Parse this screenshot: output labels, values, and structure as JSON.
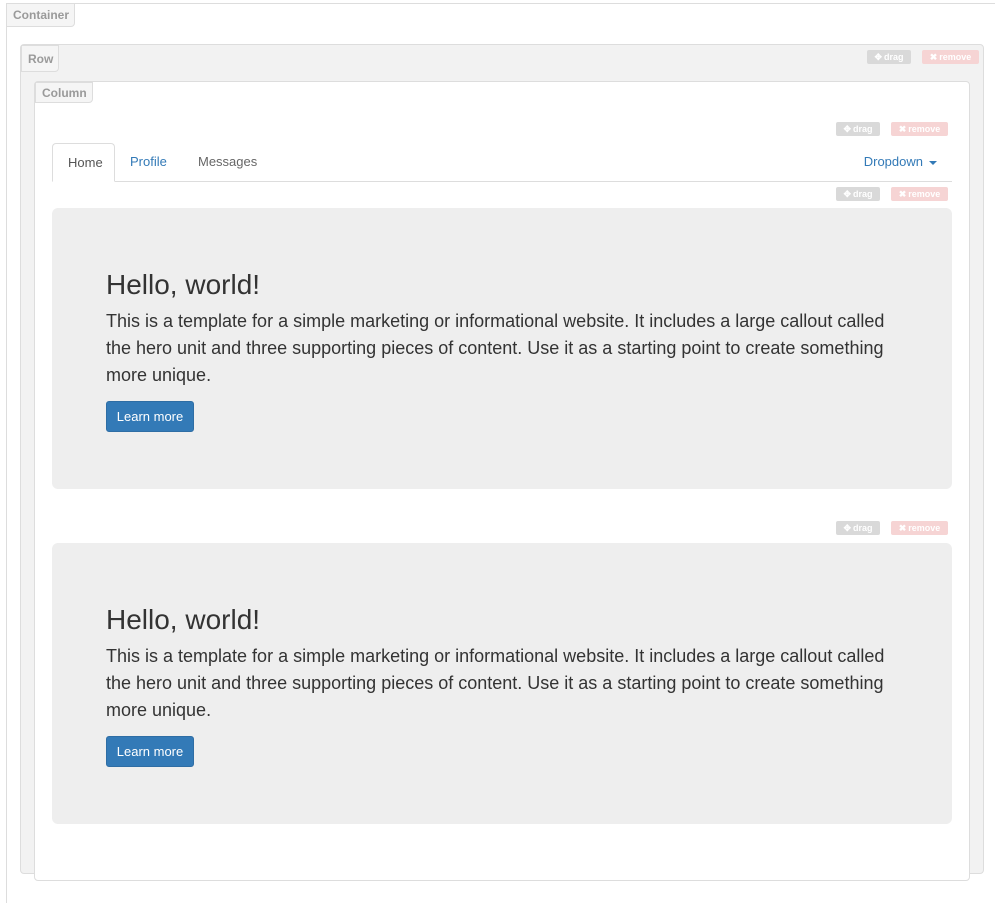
{
  "labels": {
    "container": "Container",
    "row": "Row",
    "column": "Column",
    "drag": "drag",
    "remove": "remove"
  },
  "icons": {
    "drag": "move-arrows-icon",
    "remove": "x-icon"
  },
  "tabs": [
    {
      "label": "Home",
      "active": true
    },
    {
      "label": "Profile",
      "active": false
    },
    {
      "label": "Messages",
      "active": false
    }
  ],
  "dropdown": {
    "label": "Dropdown"
  },
  "jumbotrons": [
    {
      "heading": "Hello, world!",
      "text": "This is a template for a simple marketing or informational website. It includes a large callout called the hero unit and three supporting pieces of content. Use it as a starting point to create something more unique.",
      "button": "Learn more"
    },
    {
      "heading": "Hello, world!",
      "text": "This is a template for a simple marketing or informational website. It includes a large callout called the hero unit and three supporting pieces of content. Use it as a starting point to create something more unique.",
      "button": "Learn more"
    }
  ],
  "colors": {
    "primary": "#337ab7",
    "jumbotron_bg": "#eeeeee",
    "remove_bg": "#f6d4d4",
    "drag_bg": "#d9d9d9"
  }
}
